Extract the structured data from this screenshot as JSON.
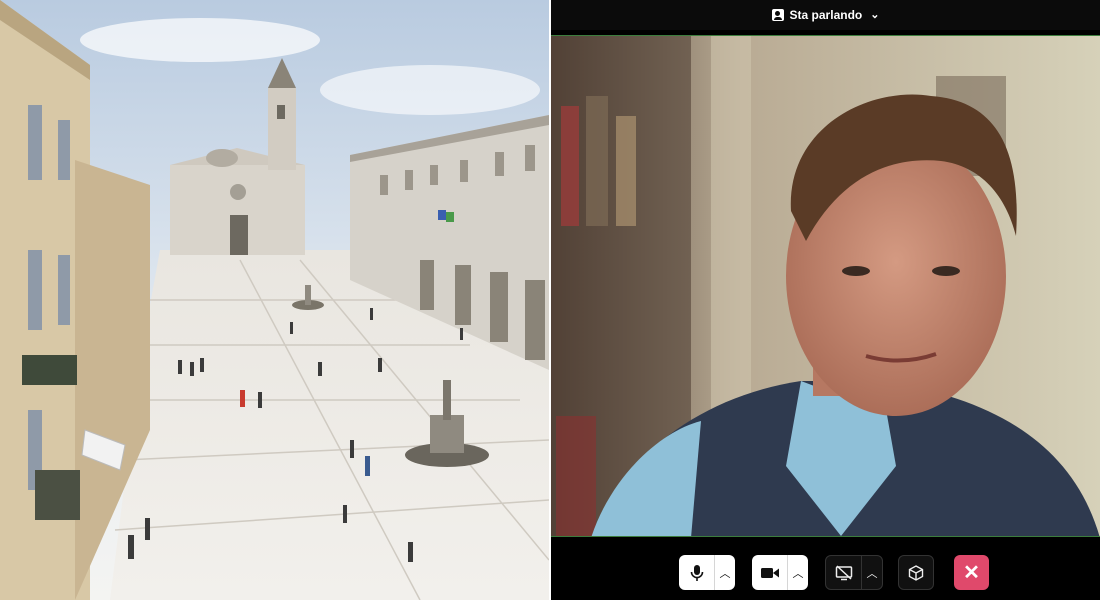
{
  "call": {
    "speaker_view_label": "Sta parlando",
    "controls": [
      {
        "name": "microphone-button",
        "icon": "microphone-icon"
      },
      {
        "name": "camera-button",
        "icon": "video-camera-icon"
      },
      {
        "name": "screen-share-button",
        "icon": "screen-share-off-icon"
      },
      {
        "name": "apps-button",
        "icon": "cube-icon"
      },
      {
        "name": "leave-call-button",
        "icon": "close-icon"
      }
    ]
  },
  "colors": {
    "leave_button": "#e0496b",
    "active_speaker_border": "#3c7d3d",
    "toolbar_background": "#000000"
  }
}
